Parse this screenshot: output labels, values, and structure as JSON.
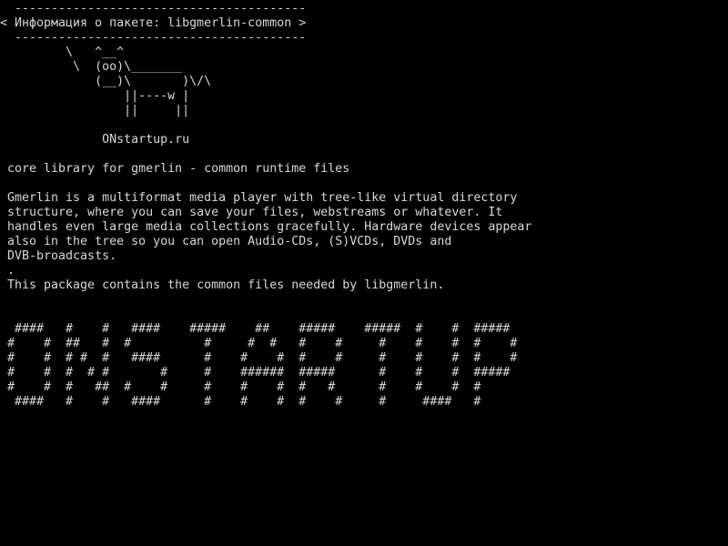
{
  "colors": {
    "background": "#000000",
    "foreground": "#d8d8d8"
  },
  "cowsay": {
    "rule_top": " ----------------------------------------",
    "title": "< Информация о пакете: libgmerlin-common >",
    "rule_bottom": " ----------------------------------------",
    "cow": [
      "        \\   ^__^",
      "         \\  (oo)\\_______",
      "            (__)\\       )\\/\\",
      "                ||----w |",
      "                ||     ||"
    ],
    "site": "             ONstartup.ru"
  },
  "package": {
    "summary": "core library for gmerlin - common runtime files",
    "description": [
      "Gmerlin is a multiformat media player with tree-like virtual directory",
      "structure, where you can save your files, webstreams or whatever. It",
      "handles even large media collections gracefully. Hardware devices appear",
      "also in the tree so you can open Audio-CDs, (S)VCDs, DVDs and",
      "DVB-broadcasts.",
      ".",
      "This package contains the common files needed by libgmerlin."
    ]
  },
  "ascii_banner": [
    " ####   #    #   ####    #####    ##    #####    #####  #    #  #####",
    "#    #  ##   #  #          #     #  #   #    #     #    #    #  #    #",
    "#    #  # #  #   ####      #    #    #  #    #     #    #    #  #    #",
    "#    #  #  # #       #     #    ######  #####      #    #    #  #####",
    "#    #  #   ##  #    #     #    #    #  #   #      #    #    #  #",
    " ####   #    #   ####      #    #    #  #    #     #     ####   #"
  ]
}
